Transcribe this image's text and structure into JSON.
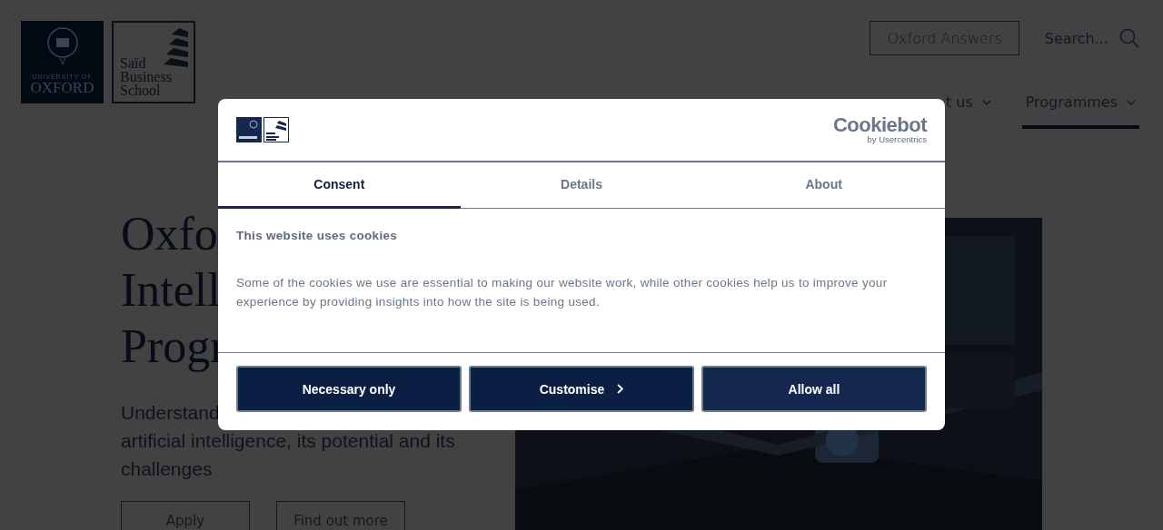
{
  "header": {
    "oxford_logo": {
      "small": "UNIVERSITY OF",
      "large": "OXFORD"
    },
    "sbs_logo": {
      "lines": [
        "Saïd",
        "Business",
        "School"
      ]
    },
    "answers_button": "Oxford Answers",
    "search": {
      "placeholder": "Search..."
    },
    "nav": [
      {
        "label": "t us",
        "selected": false
      },
      {
        "label": "Programmes",
        "selected": true
      }
    ]
  },
  "hero": {
    "heading_lines": [
      "Oxfo",
      "Intell",
      "Progr"
    ],
    "subtitle_lines": [
      "Understand",
      "artificial intelligence, its potential and its",
      "challenges"
    ],
    "buttons": [
      "Apply",
      "Find out more"
    ],
    "image": {
      "kind": "picture"
    }
  },
  "dialog": {
    "brand": {
      "name": "Cookiebot",
      "byline": "by Usercentrics"
    },
    "tabs": [
      {
        "label": "Consent",
        "selected": true
      },
      {
        "label": "Details",
        "selected": false
      },
      {
        "label": "About",
        "selected": false
      }
    ],
    "title": "This website uses cookies",
    "text": "Some of the cookies we use are essential to making our website work, while other cookies help us to improve your experience by providing insights into how the site is being used.",
    "buttons": [
      {
        "label": "Necessary only",
        "kind": "plain"
      },
      {
        "label": "Customise",
        "kind": "chevron"
      },
      {
        "label": "Allow all",
        "kind": "primary"
      }
    ]
  }
}
